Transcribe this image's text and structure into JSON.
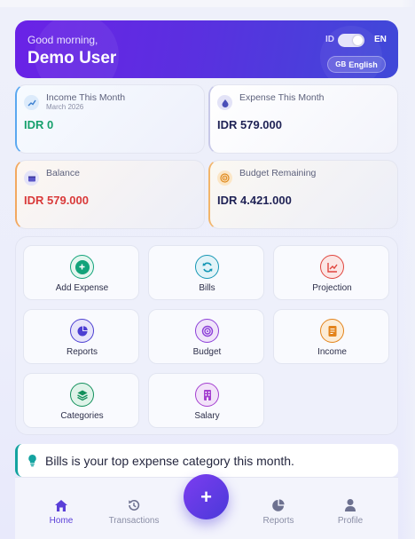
{
  "header": {
    "greeting": "Good morning,",
    "username": "Demo User",
    "lang_left": "ID",
    "lang_right": "EN",
    "lang_flag": "GB",
    "lang_select": "English"
  },
  "stats": {
    "income": {
      "title": "Income This Month",
      "sub": "March 2026",
      "value": "IDR 0",
      "color": "#16a06c",
      "icon": "trend-up-icon"
    },
    "expense": {
      "title": "Expense This Month",
      "value": "IDR 579.000",
      "color": "#1f2255",
      "icon": "drop-icon"
    },
    "balance": {
      "title": "Balance",
      "value": "IDR 579.000",
      "color": "#d93a3a",
      "icon": "wallet-icon"
    },
    "remaining": {
      "title": "Budget Remaining",
      "value": "IDR 4.421.000",
      "color": "#1f2255",
      "icon": "target-icon"
    }
  },
  "actions": [
    {
      "label": "Add Expense",
      "icon": "plus-circle-icon",
      "color": "#12a37a"
    },
    {
      "label": "Bills",
      "icon": "refresh-icon",
      "color": "#1597b5"
    },
    {
      "label": "Projection",
      "icon": "chart-line-icon",
      "color": "#e0453e"
    },
    {
      "label": "Reports",
      "icon": "pie-chart-icon",
      "color": "#4c3fd2"
    },
    {
      "label": "Budget",
      "icon": "target-icon",
      "color": "#8c3fd8"
    },
    {
      "label": "Income",
      "icon": "document-icon",
      "color": "#e3831b"
    },
    {
      "label": "Categories",
      "icon": "layers-icon",
      "color": "#12905c"
    },
    {
      "label": "Salary",
      "icon": "building-icon",
      "color": "#a43fd0"
    }
  ],
  "insight": {
    "text": "Bills is your top expense category this month."
  },
  "nav": {
    "home": "Home",
    "transactions": "Transactions",
    "fab": "+",
    "reports": "Reports",
    "profile": "Profile"
  }
}
